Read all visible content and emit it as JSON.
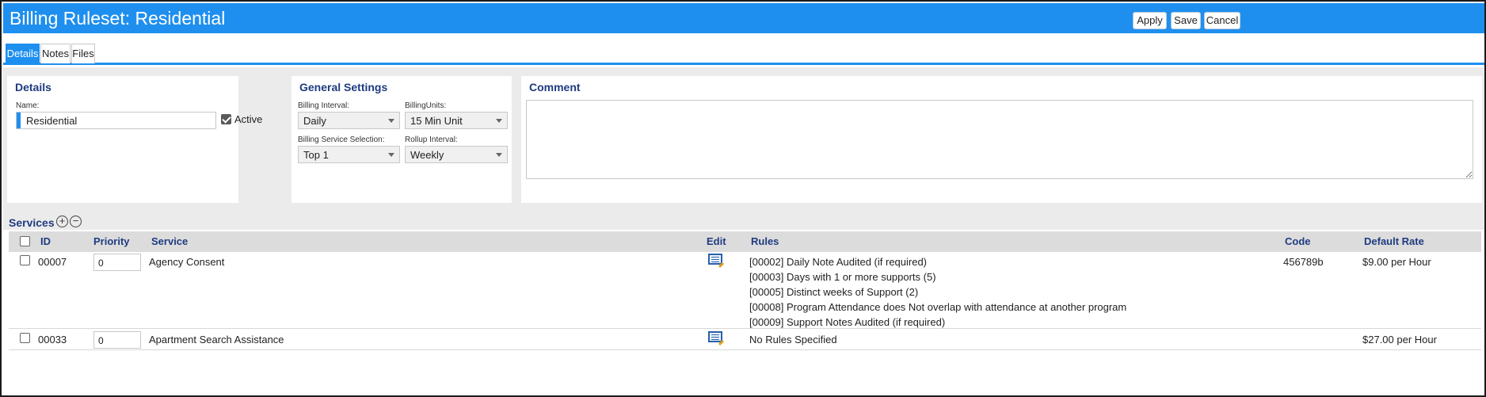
{
  "window": {
    "title": "Billing Ruleset: Residential"
  },
  "toolbar": {
    "apply_label": "Apply",
    "save_label": "Save",
    "cancel_label": "Cancel"
  },
  "tabs": [
    {
      "label": "Details",
      "active": true
    },
    {
      "label": "Notes"
    },
    {
      "label": "Files"
    }
  ],
  "details": {
    "title": "Details",
    "name_label": "Name:",
    "name_value": "Residential",
    "active_label": "Active",
    "active_checked": true
  },
  "general": {
    "title": "General Settings",
    "billing_interval_label": "Billing Interval:",
    "billing_interval_value": "Daily",
    "billing_units_label": "BillingUnits:",
    "billing_units_value": "15 Min Unit",
    "billing_service_selection_label": "Billing Service Selection:",
    "billing_service_selection_value": "Top 1",
    "rollup_interval_label": "Rollup Interval:",
    "rollup_interval_value": "Weekly"
  },
  "comment": {
    "title": "Comment",
    "value": ""
  },
  "services": {
    "title": "Services",
    "add_icon": "+",
    "remove_icon": "−",
    "columns": {
      "id": "ID",
      "priority": "Priority",
      "service": "Service",
      "edit": "Edit",
      "rules": "Rules",
      "code": "Code",
      "default_rate": "Default Rate"
    },
    "rows": [
      {
        "id": "00007",
        "priority": "0",
        "service": "Agency Consent",
        "rules": [
          "[00002] Daily Note Audited (if required)",
          "[00003] Days with 1 or more supports (5)",
          "[00005] Distinct weeks of Support (2)",
          "[00008] Program Attendance does Not overlap with attendance at another program",
          "[00009] Support Notes Audited (if required)"
        ],
        "code": "456789b",
        "default_rate": "$9.00 per Hour"
      },
      {
        "id": "00033",
        "priority": "0",
        "service": "Apartment Search Assistance",
        "rules": [
          "No Rules Specified"
        ],
        "code": "",
        "default_rate": "$27.00 per Hour"
      }
    ]
  },
  "colors": {
    "accent": "#1e8fef",
    "heading": "#1f3b80",
    "panel_bg": "#ebebeb",
    "header_row_bg": "#dcdcdc"
  },
  "icons": {
    "edit": "edit-note-icon",
    "add": "plus-circle-icon",
    "remove": "minus-circle-icon"
  }
}
